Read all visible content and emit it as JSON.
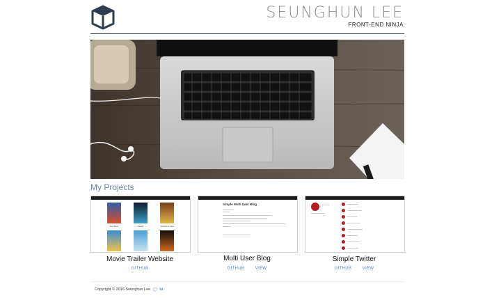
{
  "header": {
    "name": "SEUNGHUN LEE",
    "tagline": "FRONT-END NINJA",
    "logo_icon": "cube-icon"
  },
  "section": {
    "title": "My Projects"
  },
  "projects": [
    {
      "title": "Movie Trailer Website",
      "links": [
        "GITHUB"
      ],
      "thumb": {
        "type": "posters",
        "labels": [
          "Toy Story",
          "Avatar",
          "School of rock"
        ]
      }
    },
    {
      "title": "Multi User Blog",
      "links": [
        "GITHUB",
        "VIEW"
      ],
      "thumb": {
        "type": "blog",
        "heading": "Simple Multi User Blog"
      }
    },
    {
      "title": "Simple Twitter",
      "links": [
        "GITHUB",
        "VIEW"
      ],
      "thumb": {
        "type": "twitter"
      }
    }
  ],
  "footer": {
    "copyright": "Copyright © 2016 Seunghun Lee",
    "social_icons": [
      "github-icon",
      "linkedin-icon"
    ]
  },
  "colors": {
    "accent": "#6f86a8",
    "link": "#4a84c8",
    "rule": "#2c3e50"
  }
}
